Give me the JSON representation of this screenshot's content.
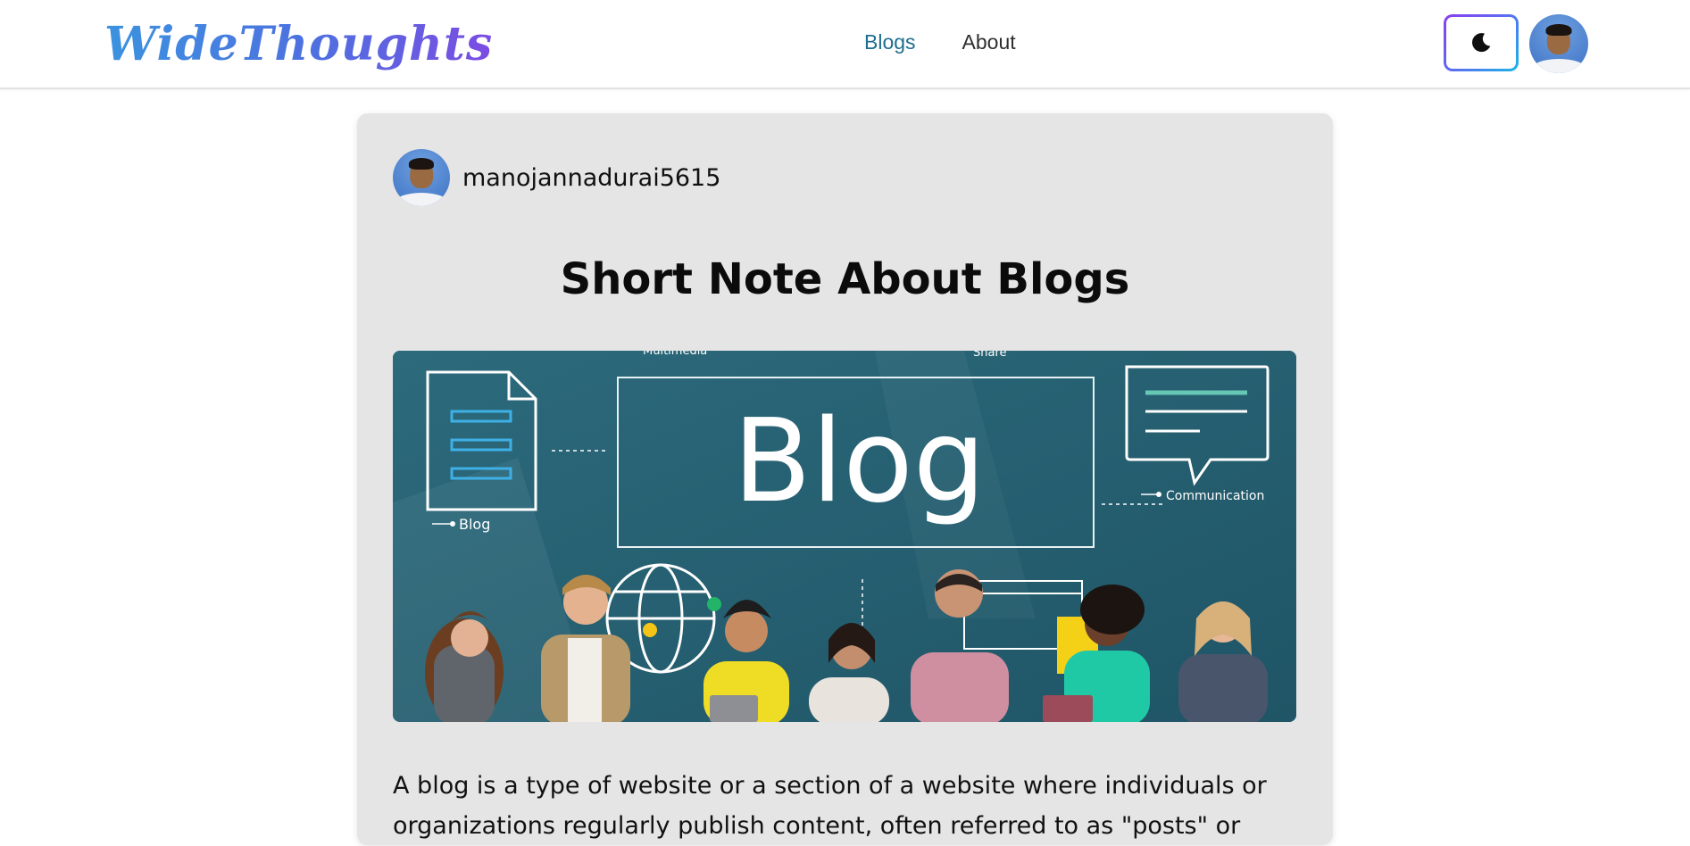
{
  "brand": {
    "logo_text": "WideThoughts"
  },
  "nav": {
    "items": [
      {
        "label": "Blogs",
        "active": true
      },
      {
        "label": "About",
        "active": false
      }
    ]
  },
  "header": {
    "theme_icon": "moon-icon",
    "avatar_icon": "user-avatar"
  },
  "colors": {
    "accent": "#1e6f8e",
    "logo_gradient_start": "#3b93df",
    "logo_gradient_end": "#7b4ce3",
    "card_bg": "#e5e5e5",
    "hero_bg": "#2f6f80"
  },
  "post": {
    "author": "manojannadurai5615",
    "title": "Short Note About Blogs",
    "hero_image": {
      "headline": "Blog",
      "labels": [
        "Multimedia",
        "Share",
        "Blog",
        "Communication"
      ]
    },
    "body": "A blog is a type of website or a section of a website where individuals or organizations regularly publish content, often referred to as \"posts\" or"
  }
}
